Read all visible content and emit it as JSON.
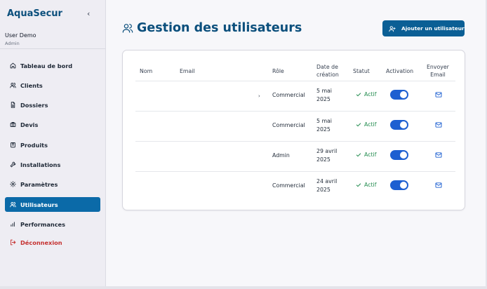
{
  "app": {
    "name": "AquaSecur",
    "collapse_glyph": "‹"
  },
  "user": {
    "name": "User Demo",
    "role": "Admin"
  },
  "sidebar": {
    "items": [
      {
        "label": "Tableau de bord",
        "icon": "home-icon"
      },
      {
        "label": "Clients",
        "icon": "users-icon"
      },
      {
        "label": "Dossiers",
        "icon": "file-icon"
      },
      {
        "label": "Devis",
        "icon": "briefcase-icon"
      },
      {
        "label": "Produits",
        "icon": "package-icon"
      },
      {
        "label": "Installations",
        "icon": "wrench-icon"
      },
      {
        "label": "Paramètres",
        "icon": "gear-icon"
      },
      {
        "label": "Utilisateurs",
        "icon": "users-icon",
        "active": true
      },
      {
        "label": "Performances",
        "icon": "bar-chart-icon"
      }
    ],
    "logout": {
      "label": "Déconnexion",
      "icon": "logout-icon"
    }
  },
  "page": {
    "title": "Gestion des utilisateurs",
    "add_button": "Ajouter un utilisateur"
  },
  "table": {
    "columns": {
      "nom": "Nom",
      "email": "Email",
      "role": "Rôle",
      "date": [
        "Date de",
        "création"
      ],
      "statut": "Statut",
      "activation": "Activation",
      "envoyer": [
        "Envoyer",
        "Email"
      ]
    },
    "rows": [
      {
        "role": "Commercial",
        "date": [
          "5 mai",
          "2025"
        ],
        "status": "Actif",
        "active": true,
        "chevron": "›"
      },
      {
        "role": "Commercial",
        "date": [
          "5 mai",
          "2025"
        ],
        "status": "Actif",
        "active": true,
        "chevron": ""
      },
      {
        "role": "Admin",
        "date": [
          "29 avril",
          "2025"
        ],
        "status": "Actif",
        "active": true,
        "chevron": ""
      },
      {
        "role": "Commercial",
        "date": [
          "24 avril",
          "2025"
        ],
        "status": "Actif",
        "active": true,
        "chevron": ""
      }
    ]
  },
  "colors": {
    "brand": "#0b4f7c",
    "active_nav": "#0b6aa8",
    "button": "#0b5f95",
    "toggle_on": "#1d5fd1",
    "status_green": "#1f8a4c",
    "logout_red": "#c5302f"
  }
}
